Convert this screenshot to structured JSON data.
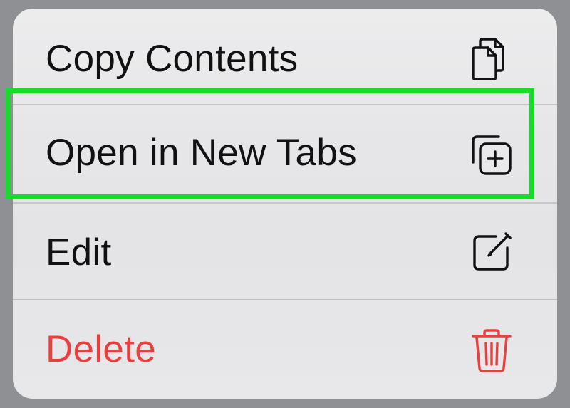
{
  "context_menu": {
    "items": [
      {
        "label": "Copy Contents",
        "icon": "copy-icon",
        "color": "#111114"
      },
      {
        "label": "Open in New Tabs",
        "icon": "open-new-tabs-icon",
        "color": "#111114"
      },
      {
        "label": "Edit",
        "icon": "edit-icon",
        "color": "#111114"
      },
      {
        "label": "Delete",
        "icon": "trash-icon",
        "color": "#e8403f"
      }
    ]
  },
  "highlight": {
    "target": "Open in New Tabs",
    "color": "#18dc2c"
  }
}
